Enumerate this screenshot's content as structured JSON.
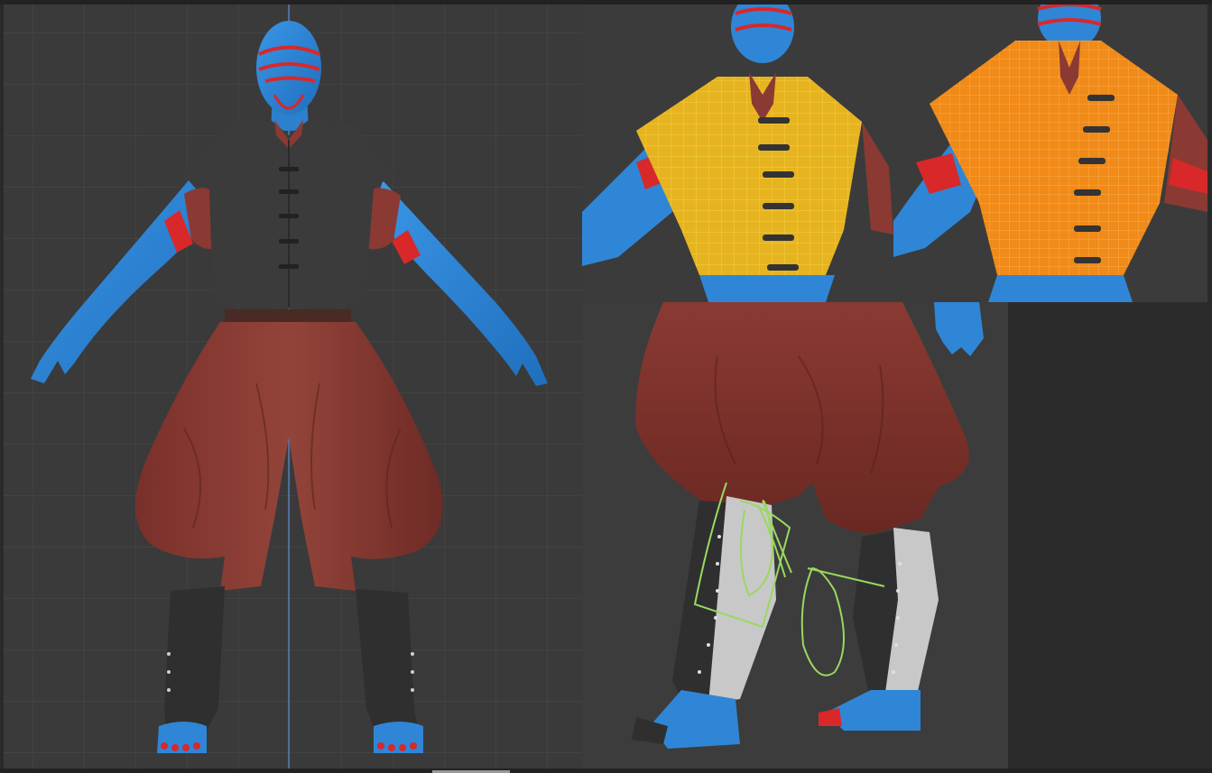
{
  "colors": {
    "background": "#3a3a3a",
    "grid": "#4a4a4a",
    "axis_line": "#5b7fb8",
    "skin": "#2f86d6",
    "stripe": "#d8282a",
    "vest": "#3a3a3a",
    "trousers": "#8a3a32",
    "belt": "#4a2a24",
    "boot": "#2f2f2f",
    "lace_wrap": "#c8c8c8",
    "wire_yellow": "#e6b420",
    "wire_orange": "#f08a18",
    "sketch_green": "#9ad860"
  },
  "panels": {
    "main_view": {
      "icon": "full-body-a-pose-icon"
    },
    "vest_wireframe_view": {
      "icon": "vest-wireframe-icon"
    },
    "legs_detail_view": {
      "icon": "boot-detail-icon"
    }
  }
}
